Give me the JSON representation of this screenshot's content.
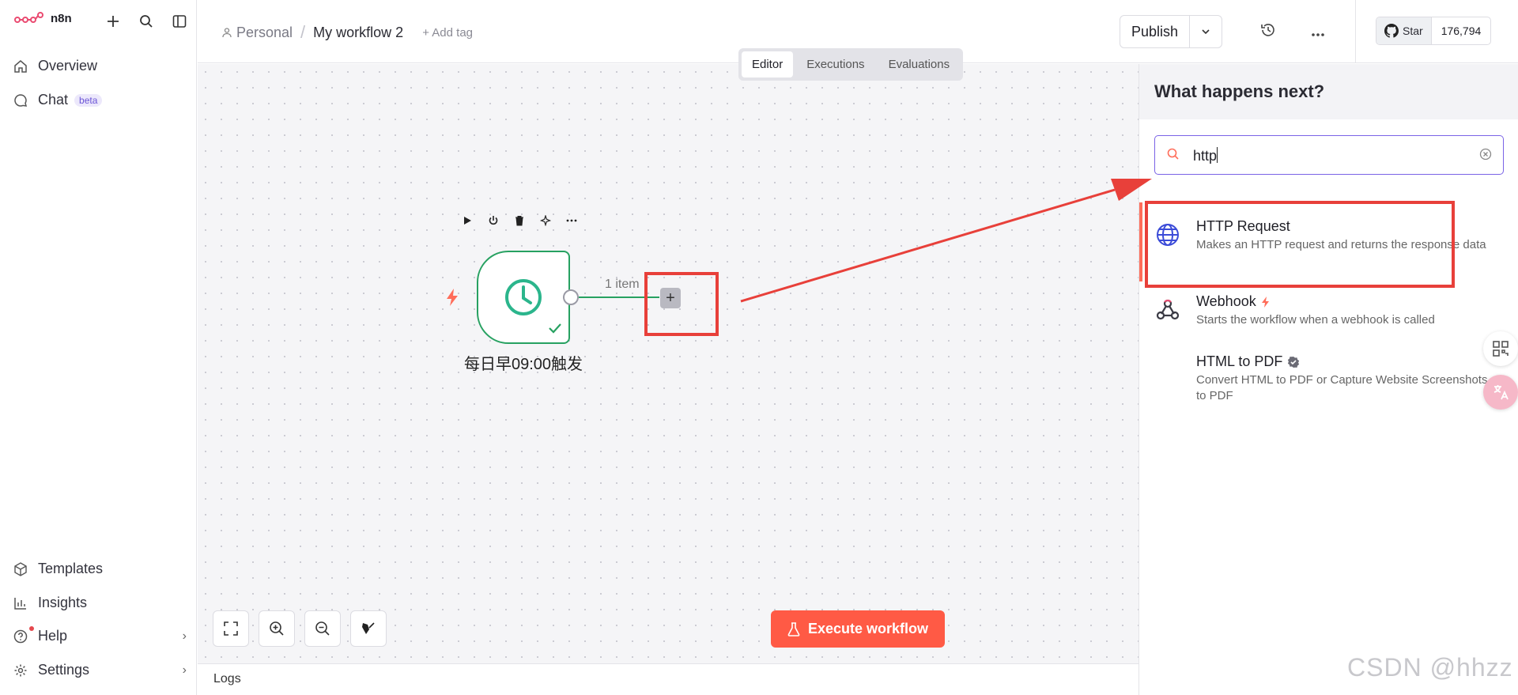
{
  "app": {
    "logo_text": "n8n"
  },
  "sidebar": {
    "top_items": [
      {
        "label": "Overview",
        "icon": "home-icon"
      },
      {
        "label": "Chat",
        "icon": "chat-icon",
        "badge": "beta"
      }
    ],
    "bottom_items": [
      {
        "label": "Templates",
        "icon": "templates-icon"
      },
      {
        "label": "Insights",
        "icon": "insights-icon"
      },
      {
        "label": "Help",
        "icon": "help-icon",
        "has_dot": true
      },
      {
        "label": "Settings",
        "icon": "gear-icon"
      }
    ]
  },
  "header": {
    "breadcrumb_project": "Personal",
    "breadcrumb_separator": "/",
    "workflow_name": "My workflow 2",
    "add_tag": "+ Add tag",
    "publish_label": "Publish",
    "star_label": "Star",
    "star_count": "176,794"
  },
  "tabs": [
    {
      "label": "Editor",
      "active": true
    },
    {
      "label": "Executions",
      "active": false
    },
    {
      "label": "Evaluations",
      "active": false
    }
  ],
  "canvas": {
    "node_title": "每日早09:00触发",
    "connection_label": "1 item",
    "plus_label": "+",
    "execute_label": "Execute workflow",
    "logs_label": "Logs"
  },
  "panel": {
    "title": "What happens next?",
    "search_value": "http",
    "results": [
      {
        "title": "HTTP Request",
        "desc": "Makes an HTTP request and returns the response data",
        "icon": "globe-icon"
      },
      {
        "title": "Webhook",
        "desc": "Starts the workflow when a webhook is called",
        "icon": "webhook-icon",
        "trigger": true
      },
      {
        "title": "HTML to PDF",
        "desc": "Convert HTML to PDF or Capture Website Screenshots to PDF",
        "icon": "",
        "verified": true
      }
    ]
  },
  "watermark": "CSDN @hhzz",
  "colors": {
    "accent": "#ff6d5a",
    "success": "#27a161",
    "annotation": "#e8403a",
    "focus": "#7a63e6"
  }
}
